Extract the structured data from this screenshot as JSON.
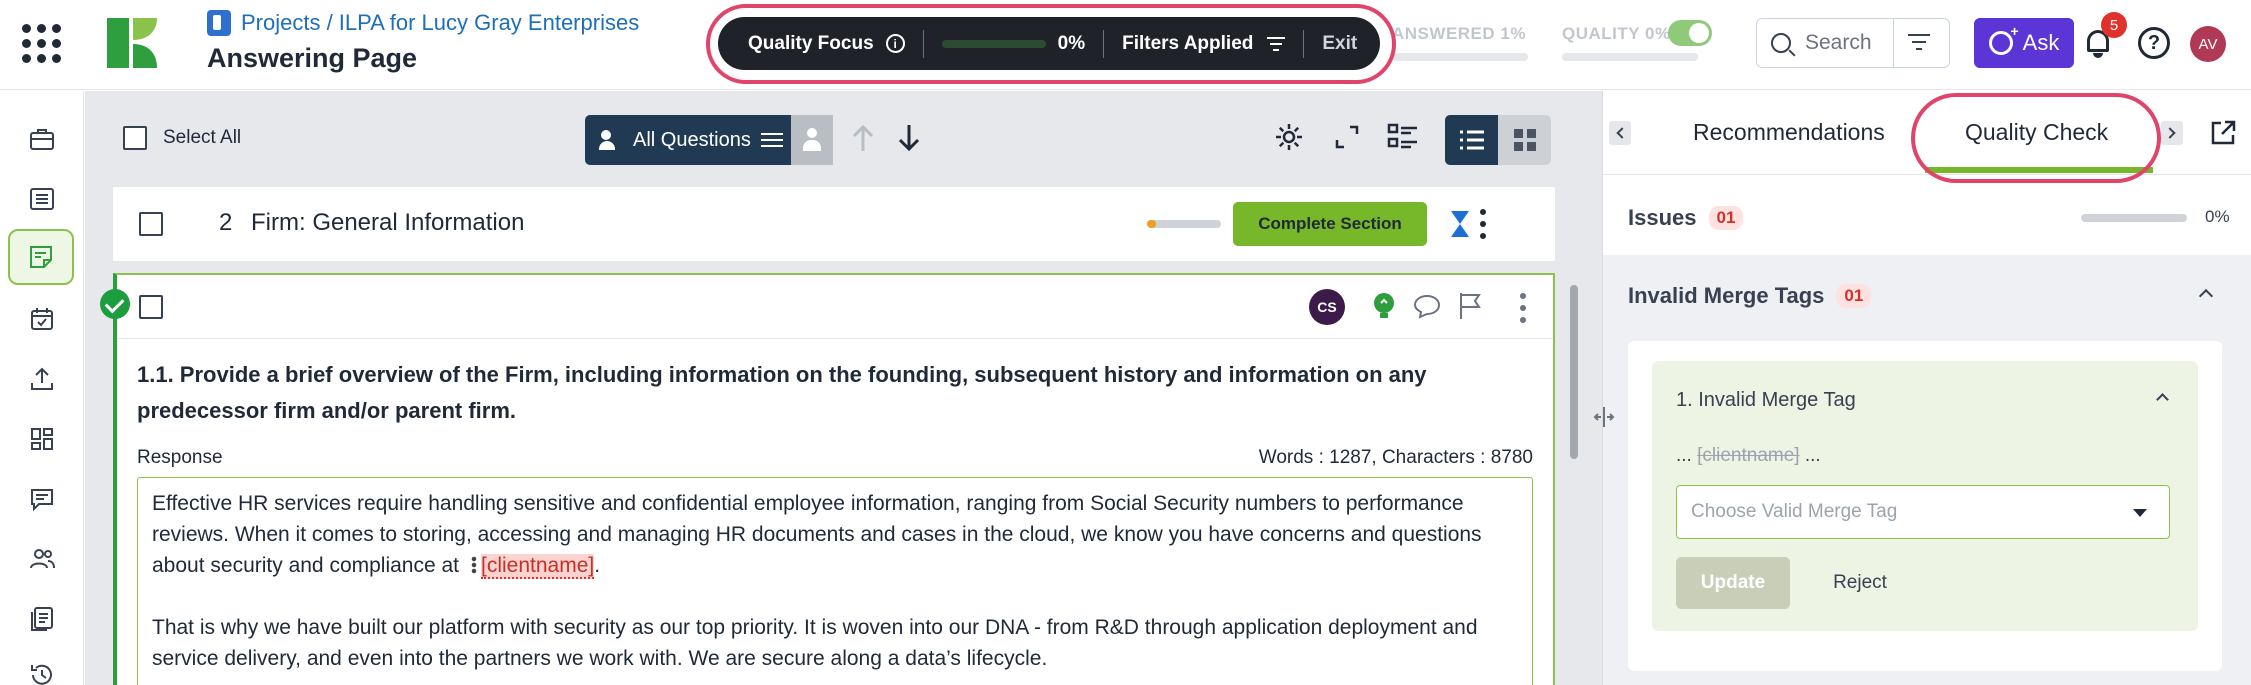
{
  "header": {
    "breadcrumb": "Projects / ILPA for Lucy Gray Enterprises",
    "page_title": "Answering Page"
  },
  "quality_focus": {
    "label": "Quality Focus",
    "info": "i",
    "progress_pct": "0%",
    "filters_label": "Filters Applied",
    "exit_label": "Exit"
  },
  "stats": {
    "answered": "ANSWERED 1%",
    "quality": "QUALITY 0%",
    "quality_toggle_on": true
  },
  "search": {
    "placeholder": "Search"
  },
  "ask": {
    "label": "Ask"
  },
  "notifications": {
    "count": "5"
  },
  "help": {
    "label": "?"
  },
  "user": {
    "initials": "AV"
  },
  "nav": {
    "icons": [
      "briefcase-icon",
      "list-icon",
      "notes-icon",
      "calendar-check-icon",
      "upload-icon",
      "dashboard-icon",
      "chat-icon",
      "users-icon",
      "documents-icon",
      "history-icon"
    ],
    "active_index": 2
  },
  "toolbar": {
    "select_all": "Select All",
    "all_questions": "All Questions"
  },
  "section": {
    "number": "2",
    "title": "Firm: General Information",
    "progress_fraction": 0.12,
    "complete_label": "Complete Section"
  },
  "question": {
    "assignee_initials": "CS",
    "text": "1.1. Provide a brief overview of the Firm, including information on the founding, subsequent history and information on any predecessor firm and/or parent firm.",
    "response_label": "Response",
    "counts": "Words : 1287, Characters : 8780",
    "response_p1": "Effective HR services require handling sensitive and confidential employee information, ranging from Social Security numbers to performance reviews. When it comes to storing, accessing and managing HR documents and cases in the cloud, we know you have concerns and questions about security and compliance at",
    "merge_tag": "[clientname]",
    "response_p1_end": ".",
    "response_p2": "That is why we have built our platform with security as our top priority. It is woven into our DNA - from R&D through application deployment and service delivery, and even into the partners we work with. We are secure along a data’s lifecycle."
  },
  "right_panel": {
    "tab_recommendations": "Recommendations",
    "tab_quality_check": "Quality Check",
    "issues_label": "Issues",
    "issues_count": "01",
    "issues_pct": "0%",
    "group_title": "Invalid Merge Tags",
    "group_count": "01",
    "item_title": "1. Invalid Merge Tag",
    "snippet_prefix": "...",
    "snippet_tag": "[clientname]",
    "snippet_suffix": "...",
    "select_placeholder": "Choose Valid Merge Tag",
    "update_label": "Update",
    "reject_label": "Reject"
  },
  "colors": {
    "accent_green": "#76b82a",
    "highlight_ring": "#e0446b",
    "ask_purple": "#5b35d5",
    "dark_navy": "#1f3a52"
  }
}
